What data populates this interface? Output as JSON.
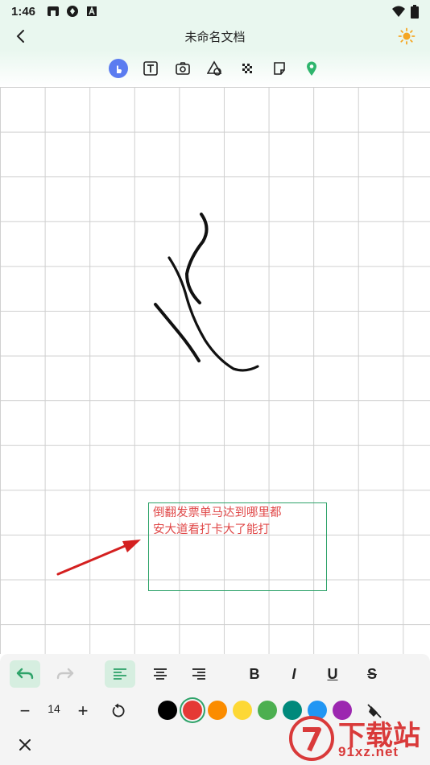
{
  "status": {
    "time": "1:46"
  },
  "header": {
    "title": "未命名文档"
  },
  "tools": [
    "touch-icon",
    "text-icon",
    "camera-icon",
    "shapes-icon",
    "mosaic-icon",
    "sticky-note-icon",
    "location-icon"
  ],
  "textbox": {
    "line1": "倒翻发票单马达到哪里都",
    "line2": "安大道看打卡大了能打",
    "color": "#e04848",
    "border_color": "#2fa36a"
  },
  "format": {
    "bold_label": "B",
    "italic_label": "I",
    "underline_label": "U",
    "strike_label": "S"
  },
  "font_size": {
    "value": "14",
    "minus": "−",
    "plus": "+"
  },
  "palette": [
    "#000000",
    "#e53935",
    "#fb8c00",
    "#fdd835",
    "#4caf50",
    "#00897b",
    "#2196f3",
    "#9c27b0"
  ],
  "selected_color": "#e53935",
  "watermark": {
    "main": "下载站",
    "site": "91xz.net"
  }
}
